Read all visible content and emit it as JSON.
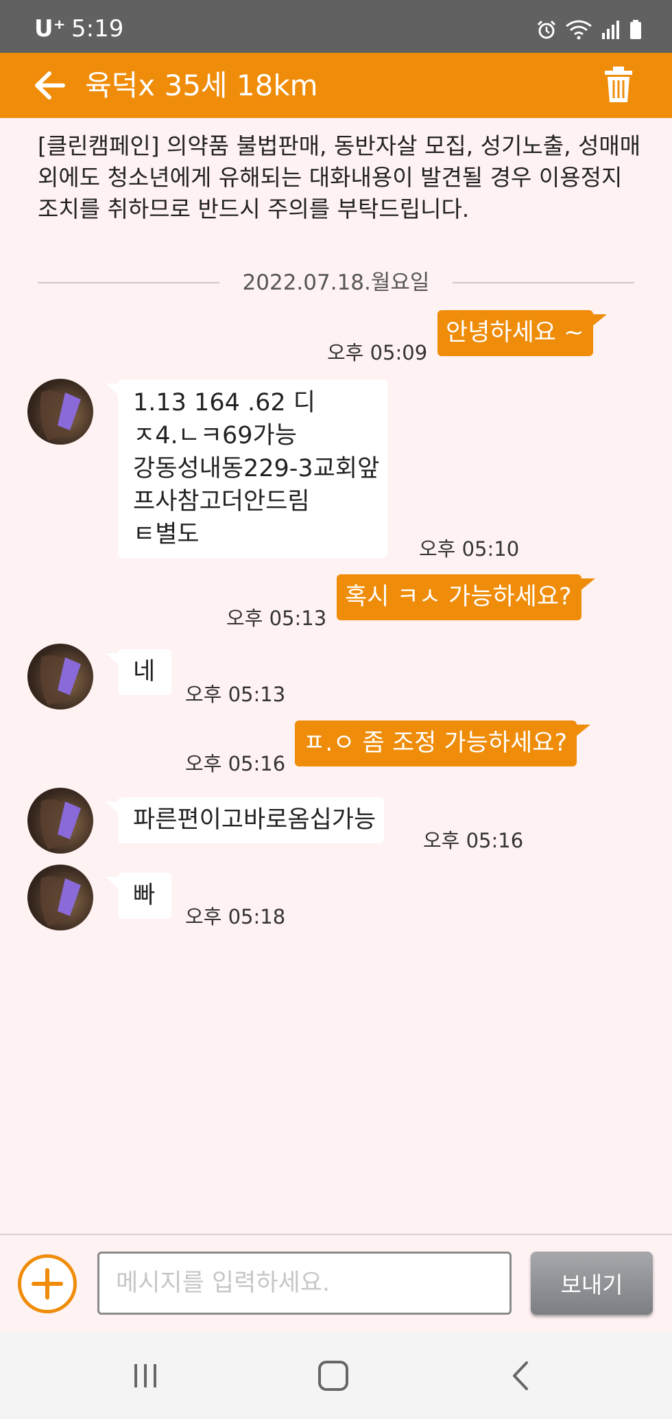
{
  "status_bar": {
    "carrier": "U⁺",
    "time": "5:19",
    "icons": [
      "alarm-icon",
      "wifi-icon",
      "signal-icon",
      "battery-icon"
    ]
  },
  "header": {
    "title": "육덕x 35세 18km",
    "back_icon": "arrow-left-icon",
    "delete_icon": "trash-icon"
  },
  "notice": {
    "text": "[클린캠페인] 의약품 불법판매, 동반자살 모집, 성기노출, 성매매 외에도 청소년에게 유해되는 대화내용이 발견될 경우 이용정지 조치를 취하므로 반드시 주의를 부탁드립니다."
  },
  "date_divider": "2022.07.18.월요일",
  "messages": [
    {
      "side": "sent",
      "text": "안녕하세요 ~",
      "time": "오후 05:09"
    },
    {
      "side": "received",
      "lines": [
        "1.13  164 .62 디",
        "ㅈ4.ㄴㅋ69가능",
        "강동성내동229-3교회앞",
        "프사참고더안드림",
        "ㅌ별도"
      ],
      "time": "오후 05:10"
    },
    {
      "side": "sent",
      "text": "혹시 ㅋㅅ 가능하세요?",
      "time": "오후 05:13"
    },
    {
      "side": "received",
      "text": "네",
      "time": "오후 05:13"
    },
    {
      "side": "sent",
      "text": "ㅍ.ㅇ 좀 조정 가능하세요?",
      "time": "오후 05:16"
    },
    {
      "side": "received",
      "text": "파른편이고바로옴십가능",
      "time": "오후 05:16"
    },
    {
      "side": "received",
      "text": "빠",
      "time": "오후 05:18"
    }
  ],
  "input": {
    "placeholder": "메시지를 입력하세요.",
    "value": "",
    "send_label": "보내기",
    "add_icon": "plus-circle-icon"
  },
  "nav": [
    "recent-apps-icon",
    "home-icon",
    "back-icon"
  ],
  "colors": {
    "accent": "#ef8c09",
    "background": "#fff2f2",
    "status_bar": "#616161"
  }
}
